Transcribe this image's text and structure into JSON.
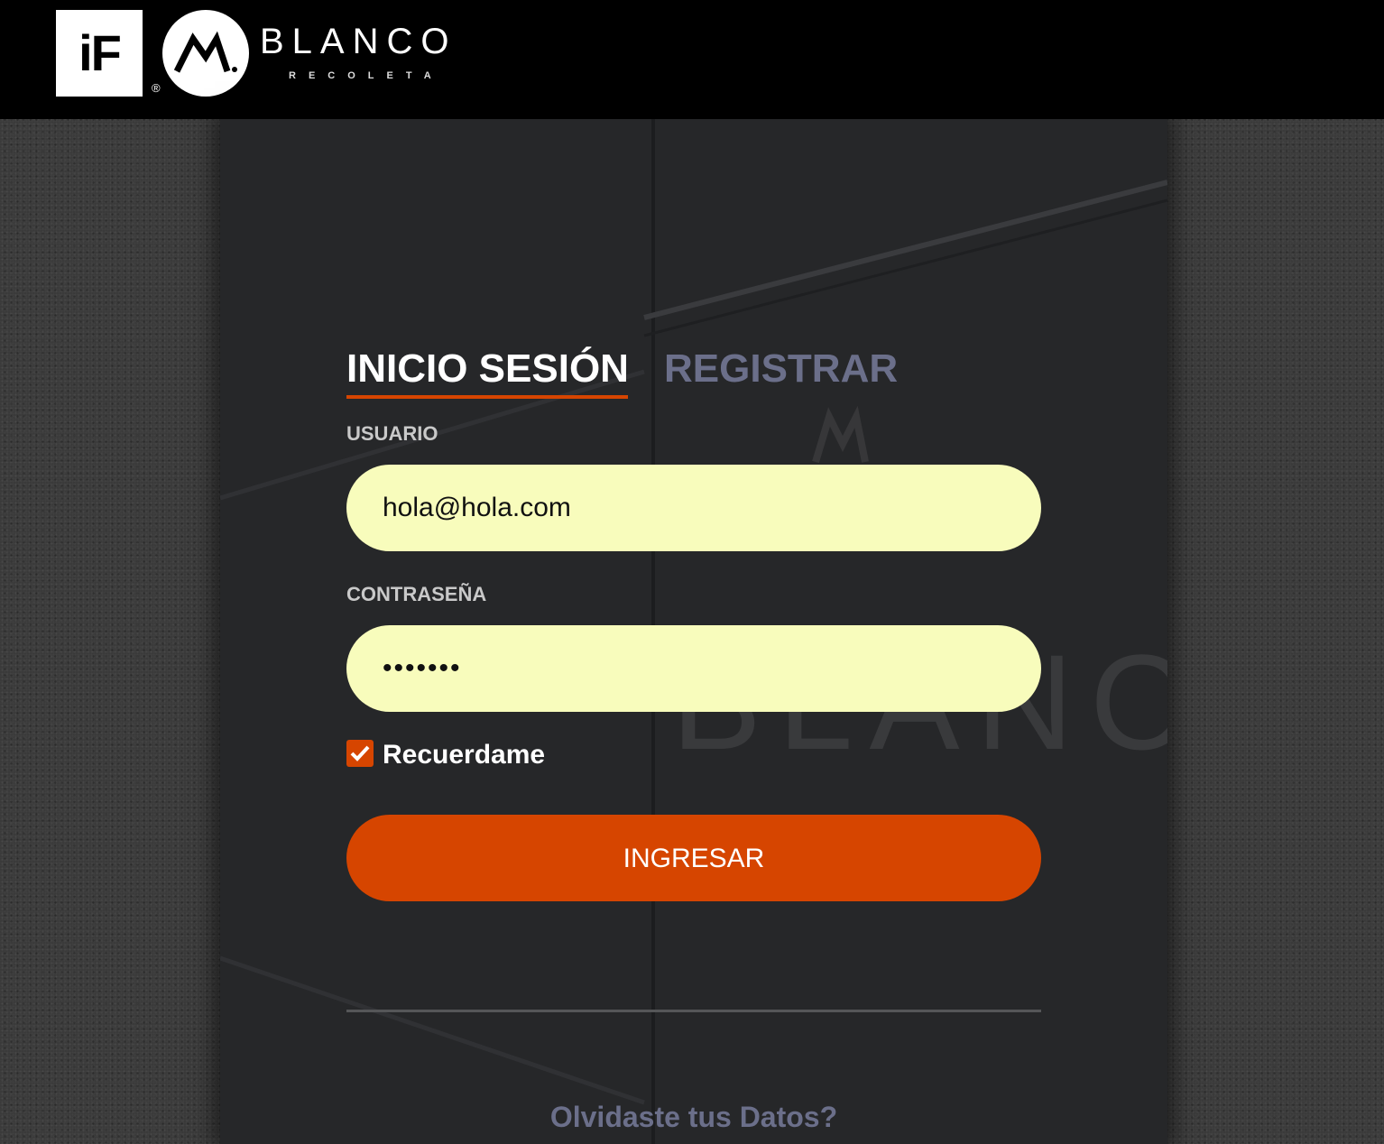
{
  "header": {
    "if_logo_text": "iF",
    "registered_mark": "®",
    "brand_icon": "m-circle-logo",
    "brand_name": "BLANCO",
    "brand_subtitle": "RECOLETA"
  },
  "background_watermark": {
    "brand_name": "BLANCO"
  },
  "auth": {
    "tabs": [
      {
        "label": "INICIO SESIÓN",
        "active": true
      },
      {
        "label": "REGISTRAR",
        "active": false
      }
    ],
    "user_label": "USUARIO",
    "user_value": "hola@hola.com",
    "password_label": "CONTRASEÑA",
    "password_value": "•••••••",
    "remember_label": "Recuerdame",
    "remember_checked": true,
    "submit_label": "INGRESAR",
    "forgot_label": "Olvidaste tus Datos?"
  },
  "colors": {
    "accent": "#d64500",
    "input_bg": "#f8fcbc",
    "inactive_tab": "#6b6f8a",
    "header_bg": "#000000"
  }
}
